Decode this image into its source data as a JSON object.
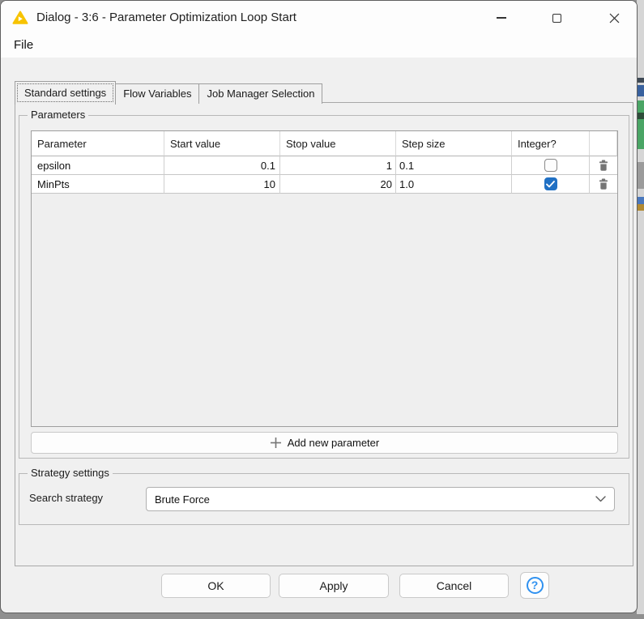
{
  "window": {
    "title": "Dialog - 3:6 - Parameter Optimization Loop Start"
  },
  "menu": {
    "file_label": "File"
  },
  "tabs": [
    {
      "label": "Standard settings",
      "selected": true
    },
    {
      "label": "Flow Variables",
      "selected": false
    },
    {
      "label": "Job Manager Selection",
      "selected": false
    }
  ],
  "parameters": {
    "group_label": "Parameters",
    "table": {
      "columns": [
        "Parameter",
        "Start value",
        "Stop value",
        "Step size",
        "Integer?"
      ],
      "rows": [
        {
          "parameter": "epsilon",
          "start": "0.1",
          "stop": "1",
          "step": "0.1",
          "integer": false
        },
        {
          "parameter": "MinPts",
          "start": "10",
          "stop": "20",
          "step": "1.0",
          "integer": true
        }
      ]
    },
    "add_button_label": "Add new parameter"
  },
  "strategy": {
    "group_label": "Strategy settings",
    "search_label": "Search strategy",
    "selected_value": "Brute Force"
  },
  "footer": {
    "ok_label": "OK",
    "apply_label": "Apply",
    "cancel_label": "Cancel",
    "help_label": "?"
  },
  "colors": {
    "checkbox_checked": "#2070c4",
    "help_accent": "#2f91f0",
    "node_icon_yellow": "#f7c300",
    "dialog_background": "#f0f0f0"
  }
}
